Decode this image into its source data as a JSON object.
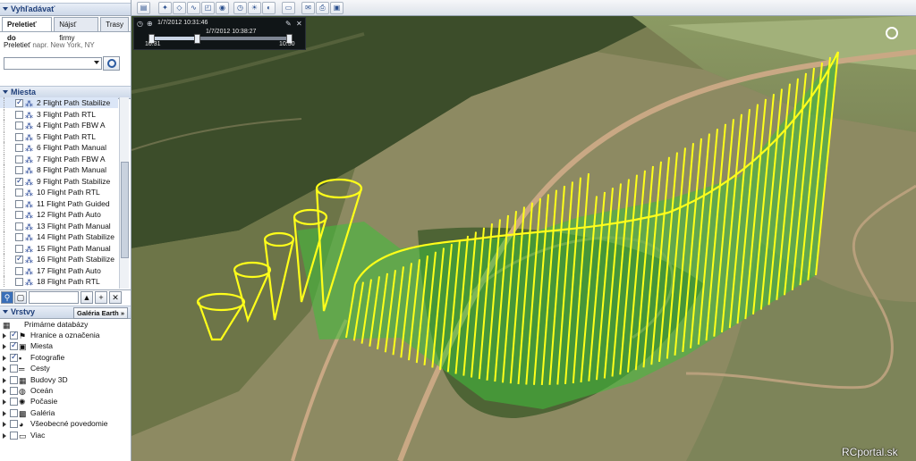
{
  "search": {
    "header": "Vyhľadávať",
    "tabs": [
      "Preletieť do",
      "Nájsť firmy",
      "Trasy"
    ],
    "fly_label": "Preletieť",
    "fly_hint": "napr. New York, NY",
    "input_value": ""
  },
  "places": {
    "header": "Miesta",
    "items": [
      {
        "label": "2 Flight Path Stabilize",
        "checked": true,
        "selected": true
      },
      {
        "label": "3 Flight Path RTL",
        "checked": false
      },
      {
        "label": "4 Flight Path FBW A",
        "checked": false
      },
      {
        "label": "5 Flight Path RTL",
        "checked": false
      },
      {
        "label": "6 Flight Path Manual",
        "checked": false
      },
      {
        "label": "7 Flight Path FBW A",
        "checked": false
      },
      {
        "label": "8 Flight Path Manual",
        "checked": false
      },
      {
        "label": "9 Flight Path Stabilize",
        "checked": true
      },
      {
        "label": "10 Flight Path RTL",
        "checked": false
      },
      {
        "label": "11 Flight Path Guided",
        "checked": false
      },
      {
        "label": "12 Flight Path Auto",
        "checked": false
      },
      {
        "label": "13 Flight Path Manual",
        "checked": false
      },
      {
        "label": "14 Flight Path Stabilize",
        "checked": false
      },
      {
        "label": "15 Flight Path Manual",
        "checked": false
      },
      {
        "label": "16 Flight Path Stabilize",
        "checked": true
      },
      {
        "label": "17 Flight Path Auto",
        "checked": false
      },
      {
        "label": "18 Flight Path RTL",
        "checked": false
      }
    ]
  },
  "layers": {
    "header": "Vrstvy",
    "gallery_button": "Galéria Earth »",
    "root": "Primárne databázy",
    "items": [
      {
        "label": "Hranice a označenia",
        "checked": true,
        "icon": "border-flag-icon"
      },
      {
        "label": "Miesta",
        "checked": true,
        "icon": "places-icon"
      },
      {
        "label": "Fotografie",
        "checked": true,
        "icon": "photo-icon"
      },
      {
        "label": "Cesty",
        "checked": false,
        "icon": "road-icon"
      },
      {
        "label": "Budovy 3D",
        "checked": false,
        "icon": "building-icon"
      },
      {
        "label": "Oceán",
        "checked": false,
        "icon": "ocean-icon"
      },
      {
        "label": "Počasie",
        "checked": false,
        "icon": "weather-icon"
      },
      {
        "label": "Galéria",
        "checked": false,
        "icon": "gallery-icon"
      },
      {
        "label": "Všeobecné povedomie",
        "checked": false,
        "icon": "globe-icon"
      },
      {
        "label": "Viac",
        "checked": false,
        "icon": "folder-icon"
      }
    ]
  },
  "timeslider": {
    "start_date": "1/7/2012  10:31:46",
    "current": "1/7/2012  10:38:27",
    "start_label": "10:31",
    "end_label": "10:50",
    "position": 0.33
  },
  "watermark": "RCportal.sk",
  "colors": {
    "panel_header": "#1f3f7a",
    "flight_path_line": "#ffff1a",
    "flight_path_fill": "#3fbf3a"
  }
}
